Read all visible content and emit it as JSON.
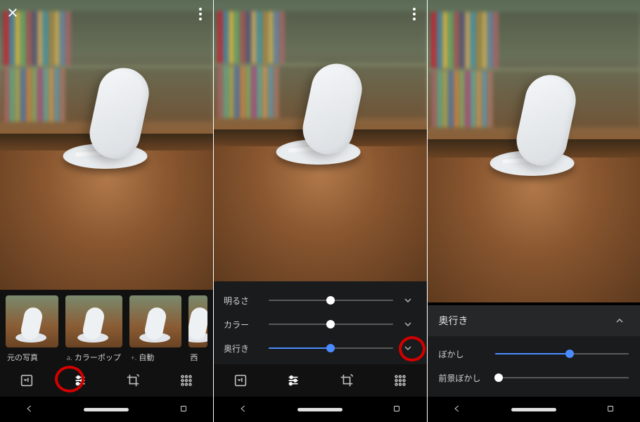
{
  "pane1": {
    "filters": [
      {
        "label": "元の写真",
        "prefix": ""
      },
      {
        "label": "カラーポップ",
        "prefix": "a."
      },
      {
        "label": "自動",
        "prefix": "+."
      },
      {
        "label": "西",
        "prefix": ""
      }
    ],
    "highlight_tool_index": 1
  },
  "pane2": {
    "sliders": [
      {
        "label": "明るさ",
        "value": 50,
        "color": "white",
        "expanded": false
      },
      {
        "label": "カラー",
        "value": 50,
        "color": "white",
        "expanded": false
      },
      {
        "label": "奥行き",
        "value": 50,
        "color": "blue",
        "expanded": false,
        "highlight_expand": true
      }
    ]
  },
  "pane3": {
    "header": "奥行き",
    "sliders": [
      {
        "label": "ぼかし",
        "value": 56,
        "color": "blue"
      },
      {
        "label": "前景ぼかし",
        "value": 3,
        "color": "white"
      }
    ]
  },
  "tools": [
    "enhance",
    "adjust",
    "crop",
    "apps"
  ],
  "colors": {
    "accent": "#4a8cff",
    "mark": "#d40000"
  }
}
